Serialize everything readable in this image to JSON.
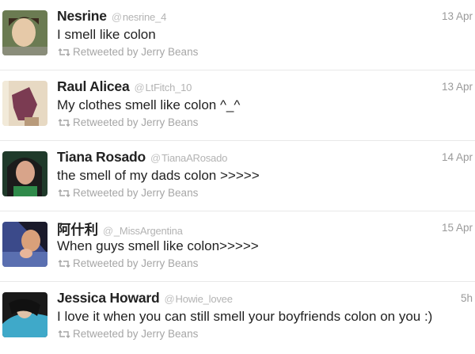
{
  "tweets": [
    {
      "name": "Nesrine",
      "handle": "nesrine_4",
      "time": "13 Apr",
      "text": "I smell like colon",
      "retweeted_by": "Retweeted by Jerry Beans",
      "avatar_colors": [
        "#6b7b52",
        "#e6c9a8",
        "#3b2a1e"
      ]
    },
    {
      "name": "Raul Alicea",
      "handle": "LtFitch_10",
      "time": "13 Apr",
      "text": "My clothes smell like colon ^_^",
      "retweeted_by": "Retweeted by Jerry Beans",
      "avatar_colors": [
        "#e7d9c3",
        "#7b3b52",
        "#b89a7a"
      ]
    },
    {
      "name": "Tiana Rosado",
      "handle": "TianaARosado",
      "time": "14 Apr",
      "text": "the smell of my dads colon >>>>>",
      "retweeted_by": "Retweeted by Jerry Beans",
      "avatar_colors": [
        "#1f3a2a",
        "#d8a48a",
        "#1b1b1b"
      ]
    },
    {
      "name": "阿什利",
      "handle": "_MissArgentina",
      "time": "15 Apr",
      "text": "When guys smell like colon>>>>>",
      "retweeted_by": "Retweeted by Jerry Beans",
      "avatar_colors": [
        "#3b4a8a",
        "#d9a07a",
        "#1a1a2a"
      ]
    },
    {
      "name": "Jessica Howard",
      "handle": "Howie_lovee",
      "time": "5h",
      "text": "I love it when you can still smell your boyfriends colon on you :)",
      "retweeted_by": "Retweeted by Jerry Beans",
      "avatar_colors": [
        "#1a1a1a",
        "#3fa9c9",
        "#e0c2a8"
      ]
    }
  ]
}
